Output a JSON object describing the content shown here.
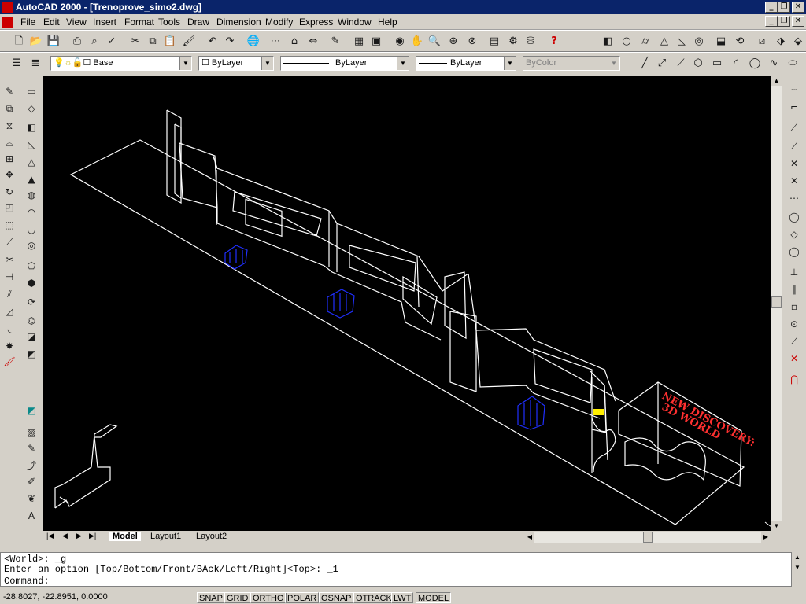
{
  "app": {
    "title": "AutoCAD 2000 - [Trenoprove_simo2.dwg]"
  },
  "menu": [
    "File",
    "Edit",
    "View",
    "Insert",
    "Format",
    "Tools",
    "Draw",
    "Dimension",
    "Modify",
    "Express",
    "Window",
    "Help"
  ],
  "toolbar_props": {
    "layer": "Base",
    "color": "ByLayer",
    "linetype": "ByLayer",
    "lineweight": "ByLayer",
    "plotstyle": "ByColor"
  },
  "drawing_text": {
    "sign_line1": "NEW DISCOVERY:",
    "sign_line2": "3D WORLD"
  },
  "tabs": [
    "Model",
    "Layout1",
    "Layout2"
  ],
  "command": {
    "line1": "<World>: _g",
    "line2": "Enter an option [Top/Bottom/Front/BAck/Left/Right]<Top>: _1",
    "prompt": "Command:"
  },
  "status": {
    "coords": "-28.8027, -22.8951, 0.0000",
    "buttons": [
      "SNAP",
      "GRID",
      "ORTHO",
      "POLAR",
      "OSNAP",
      "OTRACK",
      "LWT",
      "MODEL"
    ]
  }
}
